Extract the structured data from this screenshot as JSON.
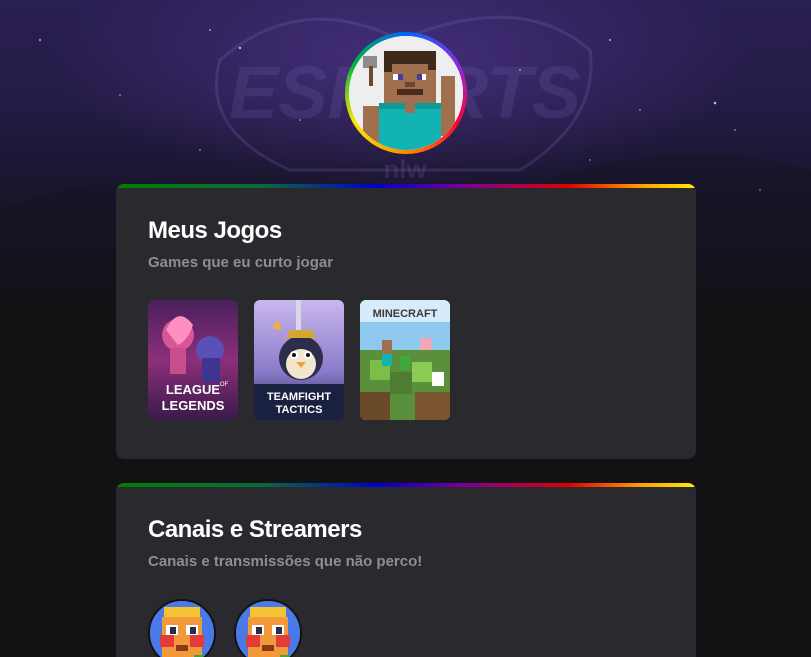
{
  "profile": {
    "avatar_icon": "minecraft-steve-avatar"
  },
  "background": {
    "logo_text": "ESPORTS",
    "logo_sub": "nlw"
  },
  "games_section": {
    "title": "Meus Jogos",
    "subtitle": "Games que eu curto jogar",
    "games": [
      {
        "name": "League of Legends",
        "line1": "LEAGUE",
        "line2": "LEGENDS",
        "of": "OF"
      },
      {
        "name": "Teamfight Tactics",
        "line1": "TEAMFIGHT",
        "line2": "TACTICS"
      },
      {
        "name": "Minecraft",
        "line1": "MINECRAFT"
      }
    ]
  },
  "streams_section": {
    "title": "Canais e Streamers",
    "subtitle": "Canais e transmissões que não perco!",
    "streamers": [
      {
        "icon": "streamer-avatar-1"
      },
      {
        "icon": "streamer-avatar-2"
      }
    ]
  },
  "colors": {
    "page_bg": "#121214",
    "card_bg": "#29292e",
    "subtitle": "#8d8d99",
    "hero_purple": "#2a1f52"
  }
}
